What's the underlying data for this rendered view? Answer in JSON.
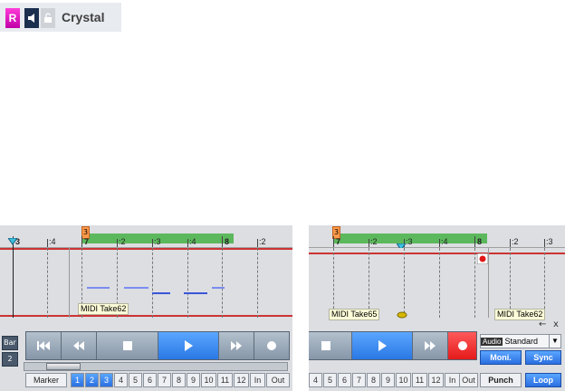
{
  "track": {
    "name": "Crystal",
    "r_label": "R",
    "colors": {
      "r": "#e020c8",
      "speaker": "#1b2f4f"
    }
  },
  "left": {
    "cursor_label": "3",
    "ruler": [
      "3",
      ":4",
      "7",
      ":2",
      ":3",
      ":4",
      "8",
      ":2"
    ],
    "clip_name": "MIDI Take62",
    "numbers": [
      "1",
      "2",
      "3",
      "4",
      "5",
      "6",
      "7",
      "8",
      "9",
      "10",
      "11",
      "12",
      "In",
      "Out"
    ],
    "marker_label": "Marker",
    "side_label": "Bar",
    "side_num": "2"
  },
  "right": {
    "cursor_label": "3",
    "ruler": [
      "7",
      ":2",
      ":3",
      ":4",
      "8",
      ":2",
      ":3"
    ],
    "clip_a": "MIDI Take65",
    "clip_b": "MIDI Take62",
    "numbers": [
      "4",
      "5",
      "6",
      "7",
      "8",
      "9",
      "10",
      "11",
      "12",
      "In",
      "Out"
    ],
    "audio_tag": "Audio",
    "audio_value": "Standard",
    "moni": "Moni.",
    "sync": "Sync",
    "punch": "Punch",
    "loop": "Loop",
    "arrow": "←",
    "close": "x"
  }
}
